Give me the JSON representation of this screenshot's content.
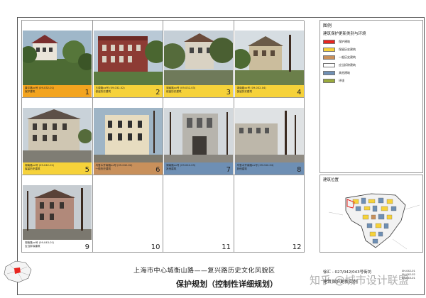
{
  "legend": {
    "heading": "图例",
    "title": "建筑保护更新类别与环境",
    "items": [
      {
        "color": "#e8251f",
        "label": "保护建筑"
      },
      {
        "color": "#f6d23a",
        "label": "保留历史建筑"
      },
      {
        "color": "#c8905b",
        "label": "一般历史建筑"
      },
      {
        "color": "#ffffff",
        "label": "应当拆除建筑"
      },
      {
        "color": "#6e8fb4",
        "label": "其他建筑"
      },
      {
        "color": "#9aaa3c",
        "label": "环境"
      }
    ]
  },
  "location": {
    "title": "建筑位置"
  },
  "cells": [
    {
      "number": "1",
      "caption1": "康平路xx号 (09-032-01)",
      "caption2": "保护建筑",
      "band_color": "#f3a41f"
    },
    {
      "number": "2",
      "caption1": "五原路xx号 (09-032-02)",
      "caption2": "保留历史建筑",
      "band_color": "#f6d23a"
    },
    {
      "number": "3",
      "caption1": "湖南路xx号 (09-032-03)",
      "caption2": "保留历史建筑",
      "band_color": "#f6d23a"
    },
    {
      "number": "4",
      "caption1": "湖南路xx号 (09-032-04)",
      "caption2": "保留历史建筑",
      "band_color": "#f6d23a"
    },
    {
      "number": "5",
      "caption1": "湖南路xx号 (09-042-01)",
      "caption2": "保留历史建筑",
      "band_color": "#f6d23a"
    },
    {
      "number": "6",
      "caption1": "乌鲁木齐南路xx号 (09-042-02)",
      "caption2": "一般历史建筑",
      "band_color": "#c8905b"
    },
    {
      "number": "7",
      "caption1": "湖南路xx号 (09-042-03)",
      "caption2": "其他建筑",
      "band_color": "#6e8fb4"
    },
    {
      "number": "8",
      "caption1": "乌鲁木齐南路xx号 (09-042-04)",
      "caption2": "其他建筑",
      "band_color": "#6e8fb4"
    },
    {
      "number": "9",
      "caption1": "湖南路xx号 (09-043-01)",
      "caption2": "应当拆除建筑",
      "band_color": "#ffffff"
    },
    {
      "number": "10"
    },
    {
      "number": "11"
    },
    {
      "number": "12"
    }
  ],
  "footer": {
    "title": "上海市中心城衡山路——复兴路历史文化风貌区",
    "subtitle": "保护规划（控制性详细规划）",
    "plot_id": "徐汇 - 027/042/043号街坊",
    "unit_name": "建筑保护更新实例",
    "sheet_numbers": [
      "XH-042-01",
      "XH-042-02",
      "XH-043-01"
    ]
  },
  "watermark": "知乎 @城市设计联盟"
}
